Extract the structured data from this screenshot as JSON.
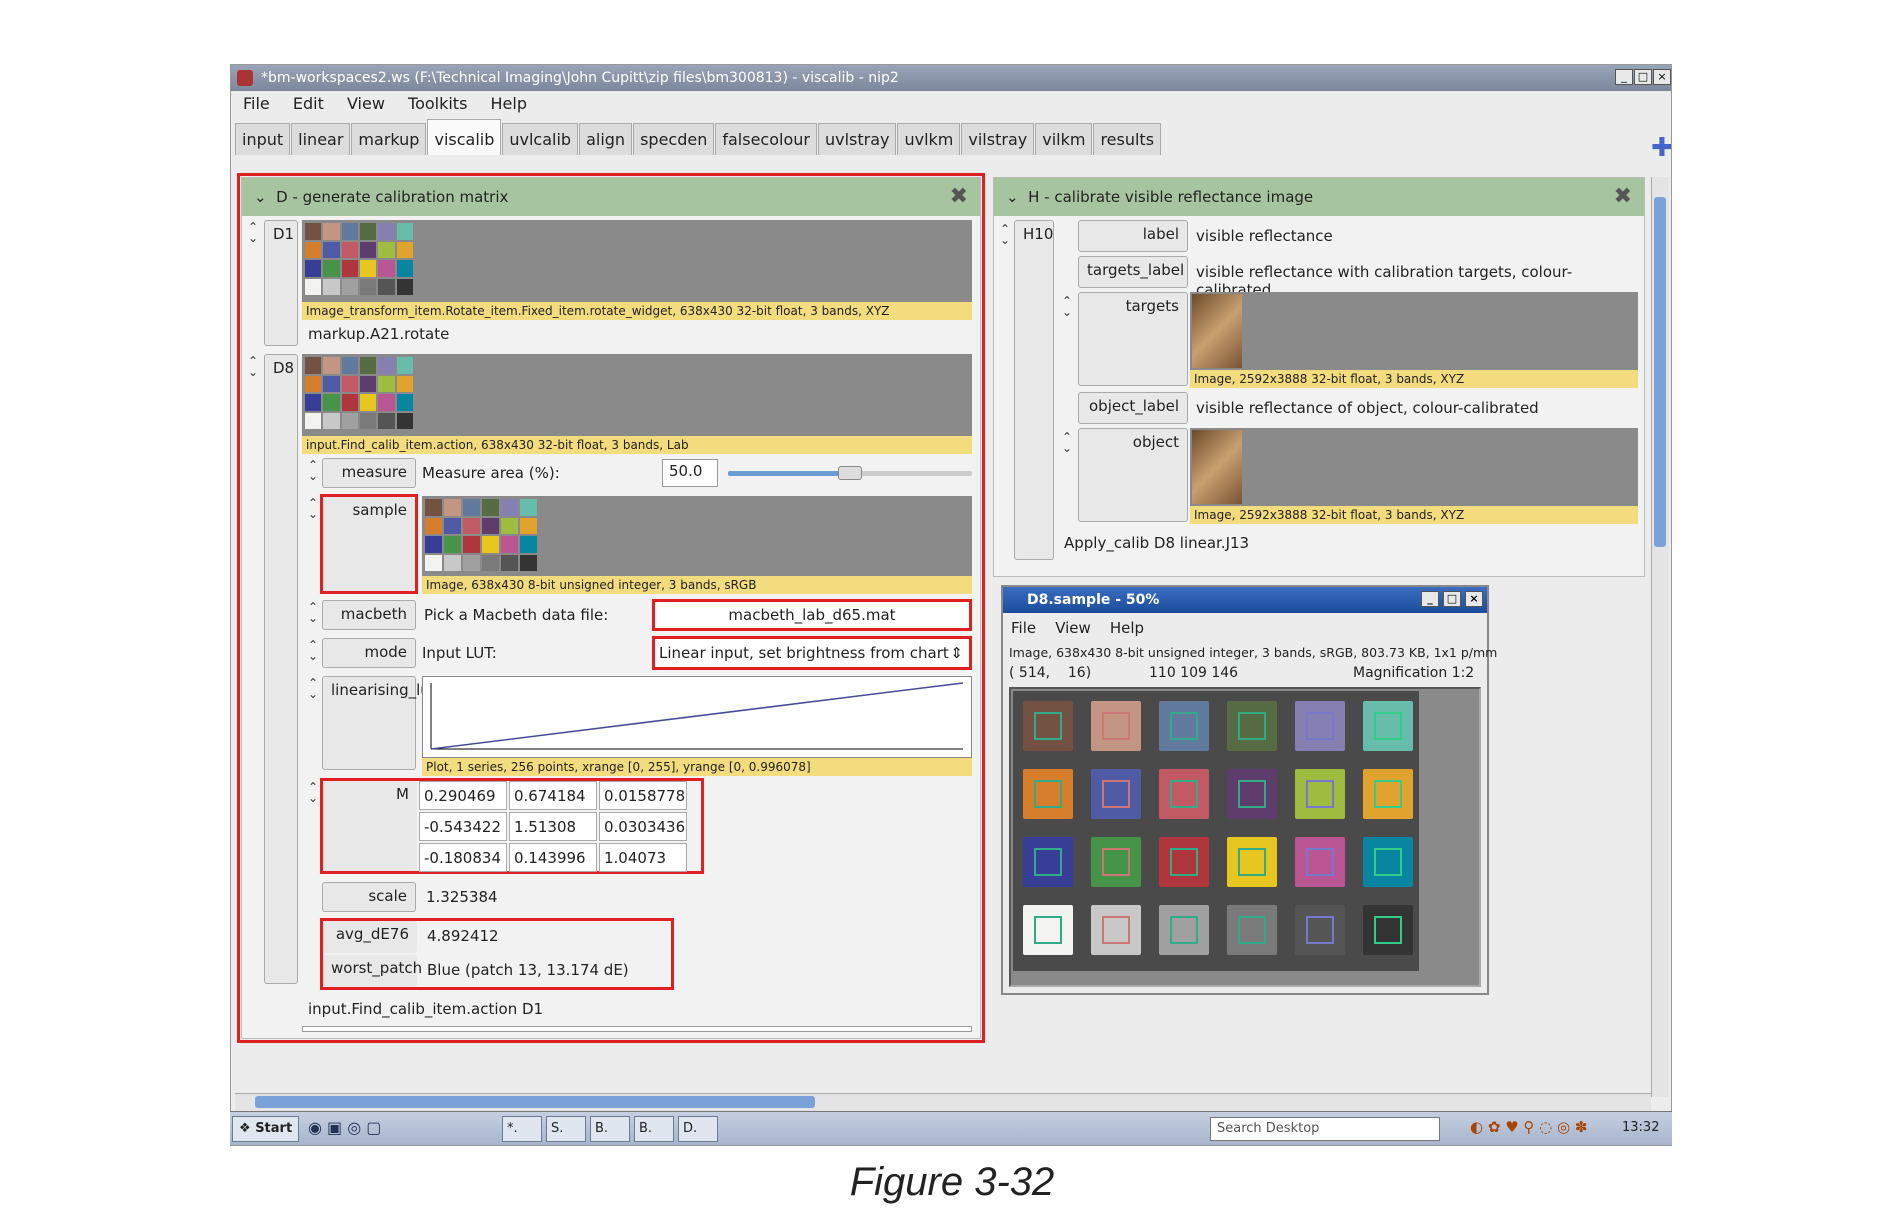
{
  "window": {
    "title": "*bm-workspaces2.ws (F:\\Technical Imaging\\John Cupitt\\zip files\\bm300813) - viscalib - nip2",
    "buttons": [
      "_",
      "□",
      "×"
    ]
  },
  "menu": [
    "File",
    "Edit",
    "View",
    "Toolkits",
    "Help"
  ],
  "tabs": [
    "input",
    "linear",
    "markup",
    "viscalib",
    "uvlcalib",
    "align",
    "specden",
    "falsecolour",
    "uvlstray",
    "uvlkm",
    "vilstray",
    "vilkm",
    "results"
  ],
  "active_tab": "viscalib",
  "panel_d": {
    "header": "D -  generate calibration matrix",
    "d1": {
      "id": "D1",
      "caption": "Image_transform_item.Rotate_item.Fixed_item.rotate_widget, 638x430 32-bit float, 3 bands, XYZ",
      "source": "markup.A21.rotate"
    },
    "d8": {
      "id": "D8",
      "caption": "input.Find_calib_item.action, 638x430 32-bit float, 3 bands, Lab",
      "measure_label": "measure",
      "measure_text": "Measure area (%):",
      "measure_value": "50.0",
      "measure_fraction": 0.5,
      "sample_label": "sample",
      "sample_caption": "Image, 638x430 8-bit unsigned integer, 3 bands, sRGB",
      "macbeth_label": "macbeth",
      "macbeth_text": "Pick a Macbeth data file:",
      "macbeth_value": "macbeth_lab_d65.mat",
      "mode_label": "mode",
      "mode_text": "Input LUT:",
      "mode_value": "Linear input, set brightness from chart",
      "lut_label": "linearising_lut",
      "lut_caption": "Plot, 1 series, 256 points, xrange [0, 255], yrange [0, 0.996078]",
      "m_label": "M",
      "matrix": [
        [
          "0.290469",
          "0.674184",
          "0.0158778"
        ],
        [
          "-0.543422",
          "1.51308",
          "0.0303436"
        ],
        [
          "-0.180834",
          "0.143996",
          "1.04073"
        ]
      ],
      "scale_label": "scale",
      "scale_value": "1.325384",
      "avg_label": "avg_dE76",
      "avg_value": "4.892412",
      "worst_label": "worst_patch",
      "worst_value": "Blue (patch 13, 13.174 dE)",
      "source": "input.Find_calib_item.action D1"
    }
  },
  "panel_h": {
    "header": "H -  calibrate visible reflectance image",
    "id": "H10",
    "label_label": "label",
    "label_value": "visible reflectance",
    "targets_label_label": "targets_label",
    "targets_label_value": "visible reflectance with calibration targets, colour-calibrated",
    "targets_label": "targets",
    "targets_caption": "Image, 2592x3888 32-bit float, 3 bands, XYZ",
    "object_label_label": "object_label",
    "object_label_value": "visible reflectance of object, colour-calibrated",
    "object_label": "object",
    "object_caption": "Image, 2592x3888 32-bit float, 3 bands, XYZ",
    "source": "Apply_calib D8 linear.J13"
  },
  "viewer": {
    "title": "D8.sample - 50%",
    "menu": [
      "File",
      "View",
      "Help"
    ],
    "info": "Image, 638x430 8-bit unsigned integer, 3 bands, sRGB, 803.73 KB, 1x1 p/mm",
    "coords": "( 514,    16)",
    "pixel": "110 109 146",
    "magnification": "Magnification 1:2"
  },
  "taskbar": {
    "start": "Start",
    "items": [
      "*.",
      "S.",
      "B.",
      "B.",
      "D."
    ],
    "search": "Search Desktop",
    "clock": "13:32"
  },
  "figure_caption": "Figure 3-32",
  "colors": {
    "highlight": "#e02020",
    "panel_header": "#a7c4a0",
    "caption_bg": "#f3dc7d"
  }
}
